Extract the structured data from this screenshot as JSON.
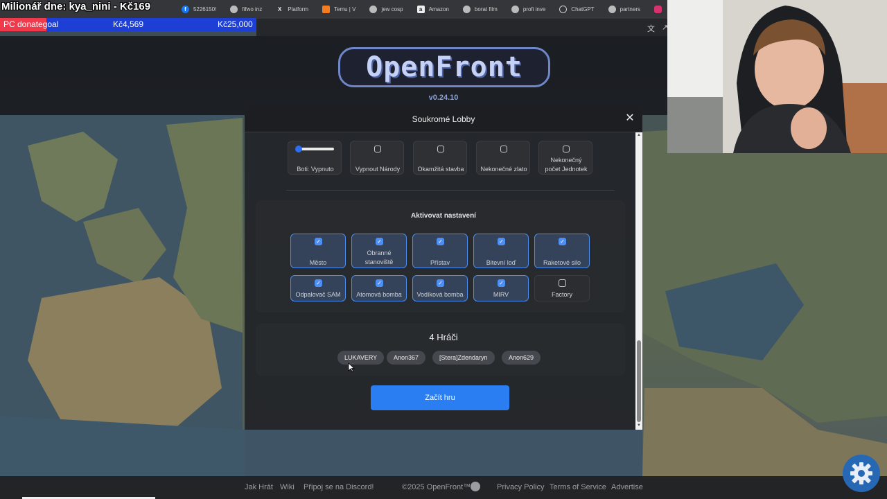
{
  "browser": {
    "overlay_title": "Milionář dne: kya_nini - Kč169",
    "bookmarks": [
      {
        "label": "5226150!",
        "icon": "facebook-icon"
      },
      {
        "label": "fifwo inz",
        "icon": "globe-icon"
      },
      {
        "label": "Platform",
        "icon": "x-icon"
      },
      {
        "label": "Temu | V",
        "icon": "temu-icon"
      },
      {
        "label": "jew cosp",
        "icon": "globe-icon"
      },
      {
        "label": "Amazon",
        "icon": "amazon-icon"
      },
      {
        "label": "borat film",
        "icon": "globe-icon"
      },
      {
        "label": "profi inve",
        "icon": "globe-icon"
      },
      {
        "label": "ChatGPT",
        "icon": "chatgpt-icon"
      },
      {
        "label": "partners",
        "icon": "globe-icon"
      }
    ]
  },
  "donation": {
    "label": "PC donategoal",
    "current": "Kč4,569",
    "goal": "Kč25,000",
    "progress": 0.18,
    "color_fill": "#f0394a",
    "color_bg": "#1d3fd6"
  },
  "logo": {
    "text": "OpenFront",
    "version": "v0.24.10"
  },
  "modal": {
    "title": "Soukromé Lobby",
    "close_symbol": "✕",
    "options": {
      "bots_label": "Boti: Vypnuto",
      "bots_value": 0,
      "disable_nations": "Vypnout Národy",
      "instant_build": "Okamžitá stavba",
      "infinite_gold": "Nekonečné zlato",
      "infinite_troops_line1": "Nekonečný",
      "infinite_troops_line2": "počet Jednotek"
    },
    "units_section_title": "Aktivovat nastavení",
    "units": [
      {
        "label": "Město",
        "enabled": true
      },
      {
        "label": "Obranné stanoviště",
        "enabled": true
      },
      {
        "label": "Přístav",
        "enabled": true
      },
      {
        "label": "Bitevní loď",
        "enabled": true
      },
      {
        "label": "Raketové silo",
        "enabled": true
      },
      {
        "label": "Odpalovač SAM",
        "enabled": true
      },
      {
        "label": "Atomová bomba",
        "enabled": true
      },
      {
        "label": "Vodíková bomba",
        "enabled": true
      },
      {
        "label": "MIRV",
        "enabled": true
      },
      {
        "label": "Factory",
        "enabled": false
      }
    ],
    "players_title": "4 Hráči",
    "players": [
      "LUKAVERY",
      "Anon367",
      "[Stera]Zdendaryn",
      "Anon629"
    ],
    "start_button": "Začít hru"
  },
  "footer": {
    "how_to_play": "Jak Hrát",
    "wiki": "Wiki",
    "discord": "Připoj se na Discord!",
    "copyright": "©2025 OpenFront™",
    "privacy": "Privacy Policy",
    "terms": "Terms of Service",
    "advertise": "Advertise"
  },
  "colors": {
    "accent": "#2a7ef2",
    "checkbox": "#4d8ff5"
  }
}
